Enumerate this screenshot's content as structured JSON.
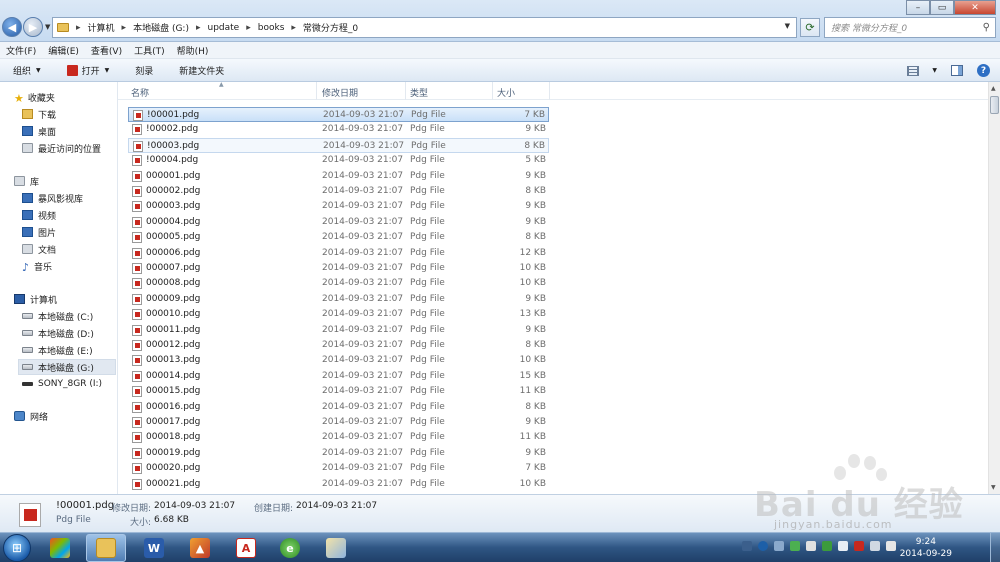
{
  "window": {
    "breadcrumbs": [
      "计算机",
      "本地磁盘 (G:)",
      "update",
      "books",
      "常微分方程_0"
    ],
    "search_placeholder": "搜索 常微分方程_0"
  },
  "menu": [
    "文件(F)",
    "编辑(E)",
    "查看(V)",
    "工具(T)",
    "帮助(H)"
  ],
  "toolbar": {
    "organize": "组织",
    "open": "打开",
    "burn": "刻录",
    "new_folder": "新建文件夹"
  },
  "nav": {
    "favorites": "收藏夹",
    "favorites_items": [
      "下载",
      "桌面",
      "最近访问的位置"
    ],
    "libraries": "库",
    "libraries_items": [
      "暴风影视库",
      "视频",
      "图片",
      "文档",
      "音乐"
    ],
    "computer": "计算机",
    "computer_items": [
      "本地磁盘 (C:)",
      "本地磁盘 (D:)",
      "本地磁盘 (E:)",
      "本地磁盘 (G:)",
      "SONY_8GR (I:)"
    ],
    "network": "网络"
  },
  "columns": {
    "name": "名称",
    "date": "修改日期",
    "type": "类型",
    "size": "大小"
  },
  "files": [
    {
      "name": "!00001.pdg",
      "date": "2014-09-03 21:07",
      "type": "Pdg File",
      "size": "7 KB"
    },
    {
      "name": "!00002.pdg",
      "date": "2014-09-03 21:07",
      "type": "Pdg File",
      "size": "9 KB"
    },
    {
      "name": "!00003.pdg",
      "date": "2014-09-03 21:07",
      "type": "Pdg File",
      "size": "8 KB"
    },
    {
      "name": "!00004.pdg",
      "date": "2014-09-03 21:07",
      "type": "Pdg File",
      "size": "5 KB"
    },
    {
      "name": "000001.pdg",
      "date": "2014-09-03 21:07",
      "type": "Pdg File",
      "size": "9 KB"
    },
    {
      "name": "000002.pdg",
      "date": "2014-09-03 21:07",
      "type": "Pdg File",
      "size": "8 KB"
    },
    {
      "name": "000003.pdg",
      "date": "2014-09-03 21:07",
      "type": "Pdg File",
      "size": "9 KB"
    },
    {
      "name": "000004.pdg",
      "date": "2014-09-03 21:07",
      "type": "Pdg File",
      "size": "9 KB"
    },
    {
      "name": "000005.pdg",
      "date": "2014-09-03 21:07",
      "type": "Pdg File",
      "size": "8 KB"
    },
    {
      "name": "000006.pdg",
      "date": "2014-09-03 21:07",
      "type": "Pdg File",
      "size": "12 KB"
    },
    {
      "name": "000007.pdg",
      "date": "2014-09-03 21:07",
      "type": "Pdg File",
      "size": "10 KB"
    },
    {
      "name": "000008.pdg",
      "date": "2014-09-03 21:07",
      "type": "Pdg File",
      "size": "10 KB"
    },
    {
      "name": "000009.pdg",
      "date": "2014-09-03 21:07",
      "type": "Pdg File",
      "size": "9 KB"
    },
    {
      "name": "000010.pdg",
      "date": "2014-09-03 21:07",
      "type": "Pdg File",
      "size": "13 KB"
    },
    {
      "name": "000011.pdg",
      "date": "2014-09-03 21:07",
      "type": "Pdg File",
      "size": "9 KB"
    },
    {
      "name": "000012.pdg",
      "date": "2014-09-03 21:07",
      "type": "Pdg File",
      "size": "8 KB"
    },
    {
      "name": "000013.pdg",
      "date": "2014-09-03 21:07",
      "type": "Pdg File",
      "size": "10 KB"
    },
    {
      "name": "000014.pdg",
      "date": "2014-09-03 21:07",
      "type": "Pdg File",
      "size": "15 KB"
    },
    {
      "name": "000015.pdg",
      "date": "2014-09-03 21:07",
      "type": "Pdg File",
      "size": "11 KB"
    },
    {
      "name": "000016.pdg",
      "date": "2014-09-03 21:07",
      "type": "Pdg File",
      "size": "8 KB"
    },
    {
      "name": "000017.pdg",
      "date": "2014-09-03 21:07",
      "type": "Pdg File",
      "size": "9 KB"
    },
    {
      "name": "000018.pdg",
      "date": "2014-09-03 21:07",
      "type": "Pdg File",
      "size": "11 KB"
    },
    {
      "name": "000019.pdg",
      "date": "2014-09-03 21:07",
      "type": "Pdg File",
      "size": "9 KB"
    },
    {
      "name": "000020.pdg",
      "date": "2014-09-03 21:07",
      "type": "Pdg File",
      "size": "7 KB"
    },
    {
      "name": "000021.pdg",
      "date": "2014-09-03 21:07",
      "type": "Pdg File",
      "size": "10 KB"
    }
  ],
  "details": {
    "name": "!00001.pdg",
    "type": "Pdg File",
    "modified_label": "修改日期:",
    "modified": "2014-09-03 21:07",
    "created_label": "创建日期:",
    "created": "2014-09-03 21:07",
    "size_label": "大小:",
    "size": "6.68 KB"
  },
  "taskbar": {
    "time": "9:24",
    "date": "2014-09-29"
  },
  "watermark": {
    "brand": "Bai du 经验",
    "url": "jingyan.baidu.com"
  },
  "colors": {
    "selection": "#cce8ff",
    "accent": "#1d5fa8",
    "pdg_icon": "#c8281e"
  }
}
